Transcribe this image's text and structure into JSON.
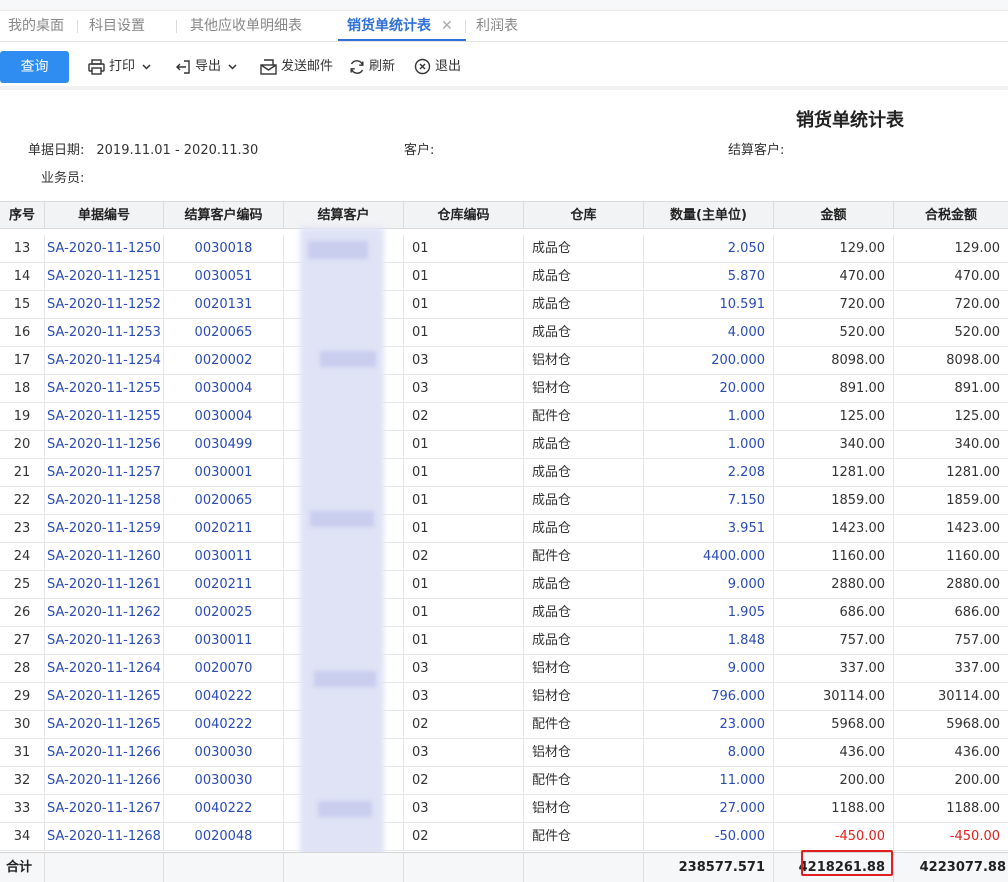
{
  "tabs": [
    {
      "label": "我的桌面"
    },
    {
      "label": "科目设置"
    },
    {
      "label": "其他应收单明细表"
    },
    {
      "label": "销货单统计表",
      "active": true
    },
    {
      "label": "利润表"
    }
  ],
  "tab_close_glyph": "✕",
  "toolbar": {
    "query": "查询",
    "print": "打印",
    "export": "导出",
    "email": "发送邮件",
    "refresh": "刷新",
    "exit": "退出"
  },
  "report": {
    "title": "销货单统计表",
    "date_label": "单据日期:",
    "date_value": "2019.11.01 - 2020.11.30",
    "customer_label": "客户:",
    "settle_customer_label": "结算客户:",
    "salesman_label": "业务员:"
  },
  "columns": [
    "序号",
    "单据编号",
    "结算客户编码",
    "结算客户",
    "仓库编码",
    "仓库",
    "数量(主单位)",
    "金额",
    "合税金额"
  ],
  "rows": [
    {
      "seq": "13",
      "doc": "SA-2020-11-1250",
      "code": "0030018",
      "wh_code": "01",
      "wh": "成品仓",
      "qty": "2.050",
      "amount": "129.00",
      "tax_amount": "129.00"
    },
    {
      "seq": "14",
      "doc": "SA-2020-11-1251",
      "code": "0030051",
      "wh_code": "01",
      "wh": "成品仓",
      "qty": "5.870",
      "amount": "470.00",
      "tax_amount": "470.00"
    },
    {
      "seq": "15",
      "doc": "SA-2020-11-1252",
      "code": "0020131",
      "wh_code": "01",
      "wh": "成品仓",
      "qty": "10.591",
      "amount": "720.00",
      "tax_amount": "720.00"
    },
    {
      "seq": "16",
      "doc": "SA-2020-11-1253",
      "code": "0020065",
      "wh_code": "01",
      "wh": "成品仓",
      "qty": "4.000",
      "amount": "520.00",
      "tax_amount": "520.00"
    },
    {
      "seq": "17",
      "doc": "SA-2020-11-1254",
      "code": "0020002",
      "wh_code": "03",
      "wh": "铝材仓",
      "qty": "200.000",
      "amount": "8098.00",
      "tax_amount": "8098.00"
    },
    {
      "seq": "18",
      "doc": "SA-2020-11-1255",
      "code": "0030004",
      "wh_code": "03",
      "wh": "铝材仓",
      "qty": "20.000",
      "amount": "891.00",
      "tax_amount": "891.00"
    },
    {
      "seq": "19",
      "doc": "SA-2020-11-1255",
      "code": "0030004",
      "wh_code": "02",
      "wh": "配件仓",
      "qty": "1.000",
      "amount": "125.00",
      "tax_amount": "125.00"
    },
    {
      "seq": "20",
      "doc": "SA-2020-11-1256",
      "code": "0030499",
      "wh_code": "01",
      "wh": "成品仓",
      "qty": "1.000",
      "amount": "340.00",
      "tax_amount": "340.00"
    },
    {
      "seq": "21",
      "doc": "SA-2020-11-1257",
      "code": "0030001",
      "wh_code": "01",
      "wh": "成品仓",
      "qty": "2.208",
      "amount": "1281.00",
      "tax_amount": "1281.00"
    },
    {
      "seq": "22",
      "doc": "SA-2020-11-1258",
      "code": "0020065",
      "wh_code": "01",
      "wh": "成品仓",
      "qty": "7.150",
      "amount": "1859.00",
      "tax_amount": "1859.00"
    },
    {
      "seq": "23",
      "doc": "SA-2020-11-1259",
      "code": "0020211",
      "wh_code": "01",
      "wh": "成品仓",
      "qty": "3.951",
      "amount": "1423.00",
      "tax_amount": "1423.00"
    },
    {
      "seq": "24",
      "doc": "SA-2020-11-1260",
      "code": "0030011",
      "wh_code": "02",
      "wh": "配件仓",
      "qty": "4400.000",
      "amount": "1160.00",
      "tax_amount": "1160.00"
    },
    {
      "seq": "25",
      "doc": "SA-2020-11-1261",
      "code": "0020211",
      "wh_code": "01",
      "wh": "成品仓",
      "qty": "9.000",
      "amount": "2880.00",
      "tax_amount": "2880.00"
    },
    {
      "seq": "26",
      "doc": "SA-2020-11-1262",
      "code": "0020025",
      "wh_code": "01",
      "wh": "成品仓",
      "qty": "1.905",
      "amount": "686.00",
      "tax_amount": "686.00"
    },
    {
      "seq": "27",
      "doc": "SA-2020-11-1263",
      "code": "0030011",
      "wh_code": "01",
      "wh": "成品仓",
      "qty": "1.848",
      "amount": "757.00",
      "tax_amount": "757.00"
    },
    {
      "seq": "28",
      "doc": "SA-2020-11-1264",
      "code": "0020070",
      "wh_code": "03",
      "wh": "铝材仓",
      "qty": "9.000",
      "amount": "337.00",
      "tax_amount": "337.00"
    },
    {
      "seq": "29",
      "doc": "SA-2020-11-1265",
      "code": "0040222",
      "wh_code": "03",
      "wh": "铝材仓",
      "qty": "796.000",
      "amount": "30114.00",
      "tax_amount": "30114.00"
    },
    {
      "seq": "30",
      "doc": "SA-2020-11-1265",
      "code": "0040222",
      "wh_code": "02",
      "wh": "配件仓",
      "qty": "23.000",
      "amount": "5968.00",
      "tax_amount": "5968.00"
    },
    {
      "seq": "31",
      "doc": "SA-2020-11-1266",
      "code": "0030030",
      "wh_code": "03",
      "wh": "铝材仓",
      "qty": "8.000",
      "amount": "436.00",
      "tax_amount": "436.00"
    },
    {
      "seq": "32",
      "doc": "SA-2020-11-1266",
      "code": "0030030",
      "wh_code": "02",
      "wh": "配件仓",
      "qty": "11.000",
      "amount": "200.00",
      "tax_amount": "200.00"
    },
    {
      "seq": "33",
      "doc": "SA-2020-11-1267",
      "code": "0040222",
      "wh_code": "03",
      "wh": "铝材仓",
      "qty": "27.000",
      "amount": "1188.00",
      "tax_amount": "1188.00"
    },
    {
      "seq": "34",
      "doc": "SA-2020-11-1268",
      "code": "0020048",
      "wh_code": "02",
      "wh": "配件仓",
      "qty": "-50.000",
      "amount": "-450.00",
      "tax_amount": "-450.00",
      "negative": true
    }
  ],
  "total": {
    "label": "合计",
    "qty": "238577.571",
    "amount": "4218261.88",
    "tax_amount": "4223077.88"
  },
  "colors": {
    "accent": "#2f8cf0",
    "tab_active": "#2f6fd8",
    "link": "#2a4bb8",
    "negative": "#e02020",
    "highlight": "#e02020"
  },
  "icons": {
    "print": "printer-icon",
    "export": "export-icon",
    "email": "email-icon",
    "refresh": "refresh-icon",
    "exit": "exit-icon"
  }
}
